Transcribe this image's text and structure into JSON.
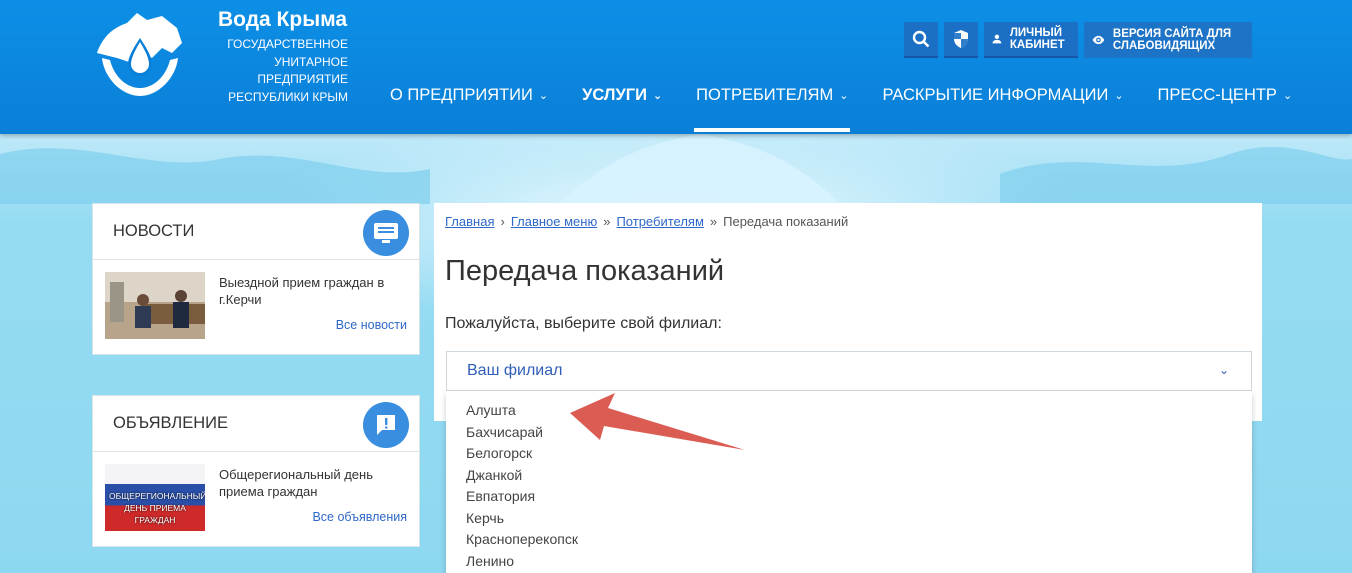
{
  "brand": {
    "title": "Вода Крыма",
    "subtitle": "ГОСУДАРСТВЕННОЕ УНИТАРНОЕ ПРЕДПРИЯТИЕ РЕСПУБЛИКИ КРЫМ",
    "logo_icon": "crimea-water-drop-hands-logo"
  },
  "top_actions": {
    "search_icon": "search-icon",
    "shield_icon": "shield-icon",
    "cabinet_label": "ЛИЧНЫЙ КАБИНЕТ",
    "vision_label": "ВЕРСИЯ САЙТА ДЛЯ СЛАБОВИДЯЩИХ"
  },
  "nav": {
    "items": [
      {
        "label": "О ПРЕДПРИЯТИИ"
      },
      {
        "label": "УСЛУГИ"
      },
      {
        "label": "ПОТРЕБИТЕЛЯМ"
      },
      {
        "label": "РАСКРЫТИЕ ИНФОРМАЦИИ"
      },
      {
        "label": "ПРЕСС-ЦЕНТР"
      }
    ],
    "active": "ПОТРЕБИТЕЛЯМ",
    "bold": "УСЛУГИ"
  },
  "news": {
    "title": "НОВОСТИ",
    "text": "Выездной прием граждан в г.Керчи",
    "link": "Все новости"
  },
  "announcement": {
    "title": "ОБЪЯВЛЕНИЕ",
    "text": "Общерегиональный день приема граждан",
    "link": "Все объявления",
    "banner_text": "ОБЩЕРЕГИОНАЛЬНЫЙ ДЕНЬ ПРИЕМА ГРАЖДАН"
  },
  "breadcrumb": {
    "home": "Главная",
    "sep1": "›",
    "menu": "Главное меню",
    "sep2": "»",
    "consumers": "Потребителям",
    "sep3": "»",
    "current": "Передача показаний"
  },
  "page": {
    "title": "Передача показаний",
    "prompt": "Пожалуйста, выберите свой филиал:"
  },
  "branch_select": {
    "placeholder": "Ваш филиал",
    "options": [
      "Алушта",
      "Бахчисарай",
      "Белогорск",
      "Джанкой",
      "Евпатория",
      "Керчь",
      "Красноперекопск",
      "Ленино"
    ]
  },
  "colors": {
    "header": "#0a7fd8",
    "accent": "#2e68c8",
    "arrow": "#d9534a"
  }
}
